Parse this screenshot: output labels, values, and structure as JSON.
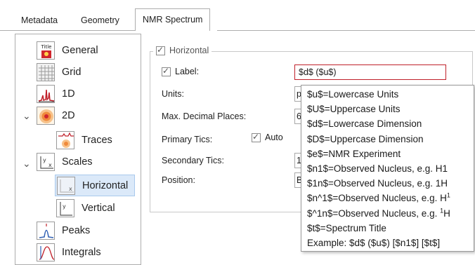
{
  "tabs": [
    {
      "label": "Metadata"
    },
    {
      "label": "Geometry"
    },
    {
      "label": "NMR Spectrum"
    }
  ],
  "tree": {
    "items": [
      {
        "label": "General",
        "icon": "title-icon"
      },
      {
        "label": "Grid",
        "icon": "grid-icon"
      },
      {
        "label": "1D",
        "icon": "spectrum-1d-icon"
      },
      {
        "label": "2D",
        "icon": "spectrum-2d-icon"
      },
      {
        "label": "Traces",
        "icon": "traces-icon"
      },
      {
        "label": "Scales",
        "icon": "scales-icon"
      },
      {
        "label": "Horizontal",
        "icon": "horizontal-scale-icon"
      },
      {
        "label": "Vertical",
        "icon": "vertical-scale-icon"
      },
      {
        "label": "Peaks",
        "icon": "peaks-icon"
      },
      {
        "label": "Integrals",
        "icon": "integrals-icon"
      }
    ],
    "selected": "Horizontal"
  },
  "form": {
    "group_title": "Horizontal",
    "label_label": "Label:",
    "label_value": "$d$ ($u$)",
    "units_label": "Units:",
    "units_value": "p",
    "decimals_label": "Max. Decimal Places:",
    "decimals_value": "6",
    "primary_label": "Primary Tics:",
    "auto_label": "Auto",
    "secondary_label": "Secondary Tics:",
    "secondary_value": "1",
    "position_label": "Position:",
    "position_value": "B"
  },
  "popup": {
    "items": [
      "$u$=Lowercase Units",
      "$U$=Uppercase Units",
      "$d$=Lowercase Dimension",
      "$D$=Uppercase Dimension",
      "$e$=NMR Experiment",
      "$n1$=Observed Nucleus, e.g. H1",
      "$1n$=Observed Nucleus, e.g. 1H"
    ],
    "item_n1sup_prefix": "$n^1$=Observed Nucleus, e.g. H",
    "item_n1sup_sup": "1",
    "item_1nsup_prefix": "$^1n$=Observed Nucleus, e.g. ",
    "item_1nsup_sup": "1",
    "item_1nsup_suffix": "H",
    "item_title": "$t$=Spectrum Title",
    "item_example": "Example: $d$ ($u$) [$n1$] [$t$]"
  },
  "colors": {
    "selection": "#dbe9f9",
    "error_border": "#c0202a"
  }
}
